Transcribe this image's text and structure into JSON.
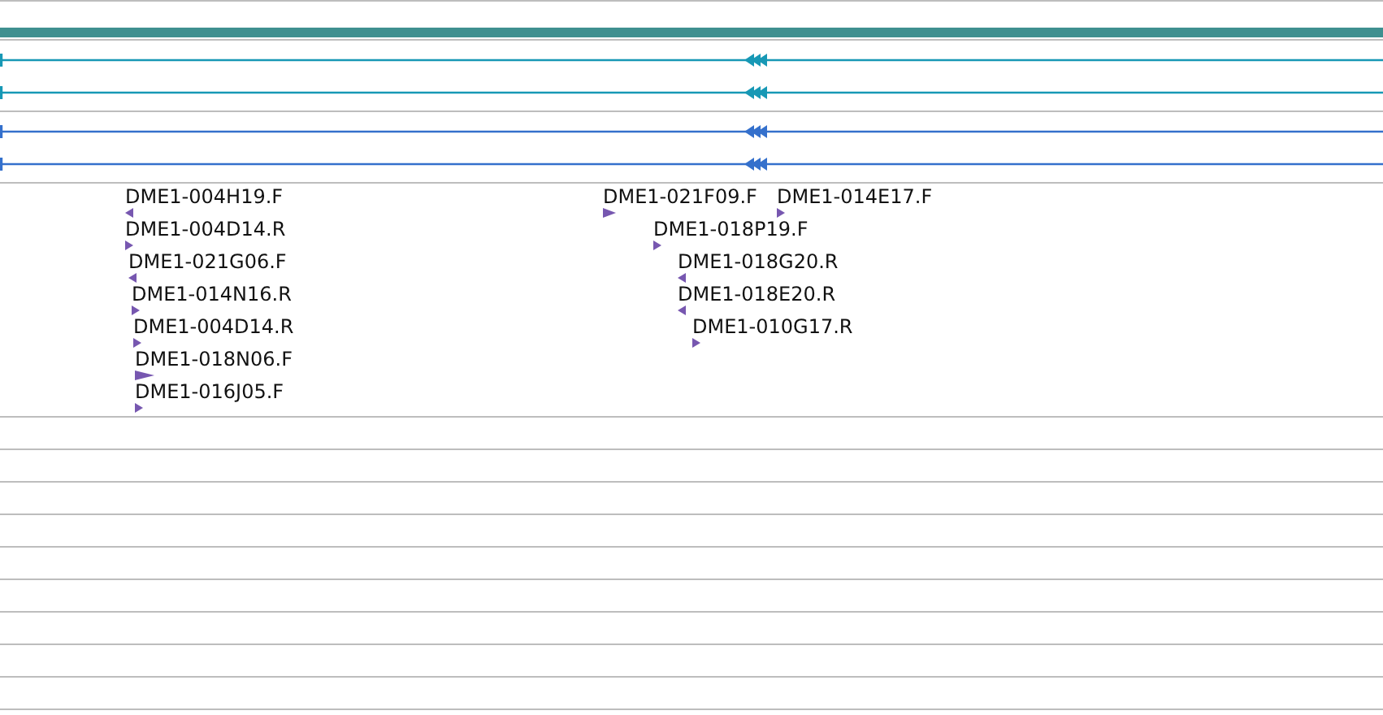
{
  "tracks": [
    {
      "color": "#1798b5"
    },
    {
      "color": "#1798b5"
    },
    {
      "color": "#3470cc"
    },
    {
      "color": "#3470cc"
    }
  ],
  "features": [
    {
      "label": "DME1-004H19.F",
      "kind": "reverse"
    },
    {
      "label": "DME1-004D14.R",
      "kind": "forward"
    },
    {
      "label": "DME1-021G06.F",
      "kind": "reverse"
    },
    {
      "label": "DME1-014N16.R",
      "kind": "forward"
    },
    {
      "label": "DME1-004D14.R",
      "kind": "forward"
    },
    {
      "label": "DME1-018N06.F",
      "kind": "forward"
    },
    {
      "label": "DME1-016J05.F",
      "kind": "forward"
    },
    {
      "label": "DME1-021F09.F",
      "kind": "forward"
    },
    {
      "label": "DME1-014E17.F",
      "kind": "forward"
    },
    {
      "label": "DME1-018P19.F",
      "kind": "forward"
    },
    {
      "label": "DME1-018G20.R",
      "kind": "reverse"
    },
    {
      "label": "DME1-018E20.R",
      "kind": "reverse"
    },
    {
      "label": "DME1-010G17.R",
      "kind": "forward"
    }
  ]
}
